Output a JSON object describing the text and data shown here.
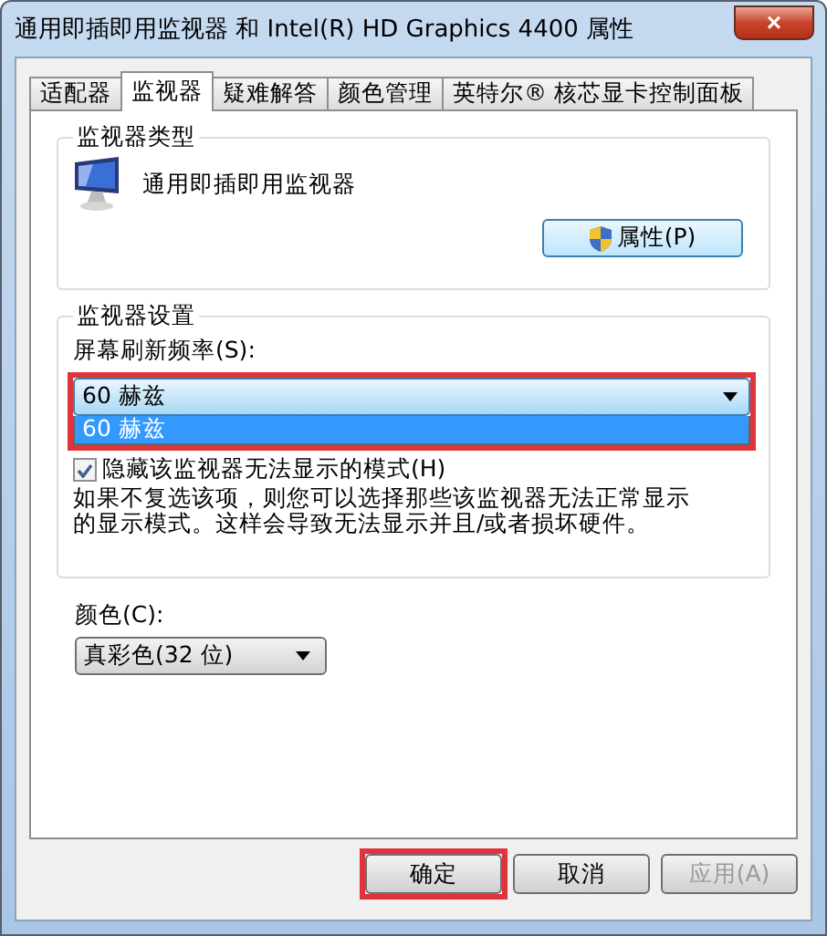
{
  "window": {
    "title": "通用即插即用监视器 和 Intel(R) HD Graphics 4400 属性",
    "close": "×"
  },
  "tabs": [
    {
      "label": "适配器",
      "selected": false
    },
    {
      "label": "监视器",
      "selected": true
    },
    {
      "label": "疑难解答",
      "selected": false
    },
    {
      "label": "颜色管理",
      "selected": false
    },
    {
      "label": "英特尔® 核芯显卡控制面板",
      "selected": false
    }
  ],
  "monitor_type": {
    "title": "监视器类型",
    "name": "通用即插即用监视器",
    "button": "属性(P)"
  },
  "monitor_settings": {
    "title": "监视器设置",
    "refresh_label": "屏幕刷新频率(S):",
    "refresh_value": "60 赫兹",
    "highlighted": true,
    "options": [
      {
        "label": "60 赫兹",
        "selected": true
      }
    ],
    "hide_modes": {
      "label": "隐藏该监视器无法显示的模式(H)",
      "checked": true
    },
    "note": "如果不复选该项，则您可以选择那些该监视器无法正常显示的显示模式。这样会导致无法显示并且/或者损坏硬件。"
  },
  "color": {
    "label": "颜色(C):",
    "value": "真彩色(32 位)"
  },
  "buttons": [
    {
      "label": "确定",
      "disabled": false,
      "highlighted": true
    },
    {
      "label": "取消",
      "disabled": false,
      "highlighted": false
    },
    {
      "label": "应用(A)",
      "disabled": true,
      "highlighted": false
    }
  ]
}
